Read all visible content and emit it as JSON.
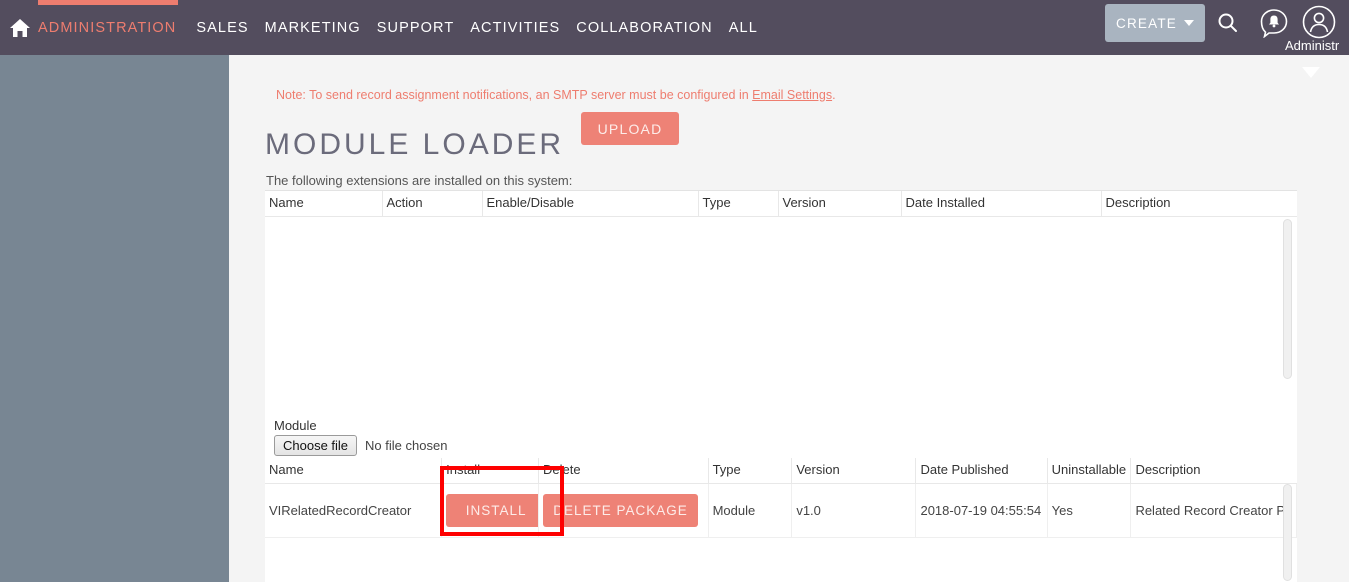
{
  "topnav": {
    "home_icon": "home-icon",
    "items": [
      {
        "label": "ADMINISTRATION",
        "active": true
      },
      {
        "label": "SALES",
        "active": false
      },
      {
        "label": "MARKETING",
        "active": false
      },
      {
        "label": "SUPPORT",
        "active": false
      },
      {
        "label": "ACTIVITIES",
        "active": false
      },
      {
        "label": "COLLABORATION",
        "active": false
      },
      {
        "label": "ALL",
        "active": false
      }
    ],
    "create_label": "CREATE",
    "search_icon": "search-icon",
    "notification_icon": "bell-notification-icon",
    "avatar_icon": "user-avatar-icon",
    "user_name": "Administr",
    "bar_color": "#534d5e",
    "accent_color": "#ee7d6f",
    "create_bg": "#a9b4c0"
  },
  "sidebar": {
    "collapse_icon": "chevron-left-icon",
    "bg_color": "#788693"
  },
  "main": {
    "collapse_chevron_icon": "chevron-down-icon",
    "note": {
      "text_before": "Note: To send record assignment notifications, an SMTP server must be configured in ",
      "link_text": "Email Settings",
      "text_after": ".",
      "color": "#ee7d6f"
    },
    "page_title": "MODULE LOADER",
    "subtitle": "The following extensions are installed on this system:"
  },
  "installed_table": {
    "headers": [
      "Name",
      "Action",
      "Enable/Disable",
      "Type",
      "Version",
      "Date Installed",
      "Description"
    ],
    "rows": []
  },
  "upload": {
    "module_label": "Module",
    "choose_file_label": "Choose file",
    "no_file_text": "No file chosen",
    "upload_label": "UPLOAD",
    "button_color": "#ee8276"
  },
  "packages_table": {
    "headers": [
      "Name",
      "Install",
      "Delete",
      "Type",
      "Version",
      "Date Published",
      "Uninstallable",
      "Description"
    ],
    "rows": [
      {
        "name": "VIRelatedRecordCreator",
        "install_label": "INSTALL",
        "delete_label": "DELETE PACKAGE",
        "type": "Module",
        "version": "v1.0",
        "date_published": "2018-07-19 04:55:54",
        "uninstallable": "Yes",
        "description": "Related Record Creator Pl"
      }
    ],
    "highlight_color": "#fe0000"
  }
}
